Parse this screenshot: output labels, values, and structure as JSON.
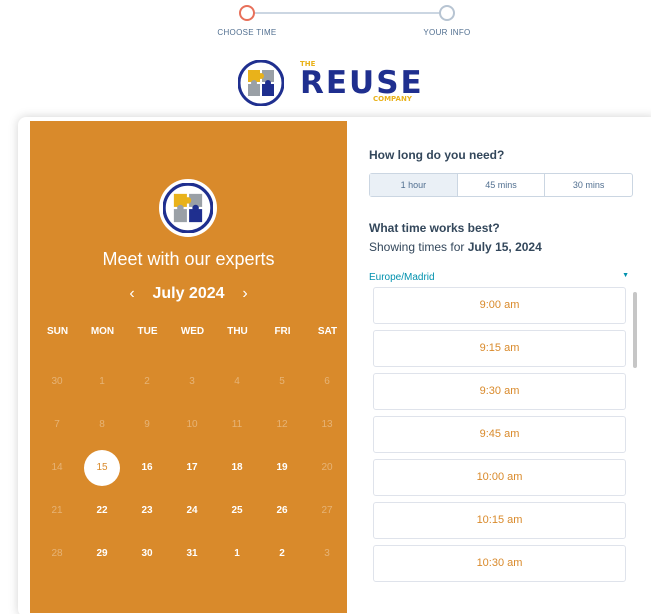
{
  "stepper": {
    "steps": [
      {
        "label": "CHOOSE TIME",
        "state": "active"
      },
      {
        "label": "YOUR INFO",
        "state": "inactive"
      }
    ]
  },
  "logo": {
    "top_text": "THE",
    "word": "REUSE",
    "bottom_text": "COMPANY",
    "icon": "puzzle-logo-icon"
  },
  "colors": {
    "accent": "#d98a2b",
    "link": "#0091ae",
    "logo_blue": "#1f2f8f",
    "logo_yellow": "#e9b21a"
  },
  "calendar": {
    "title": "Meet with our experts",
    "month_label": "July 2024",
    "prev_icon": "chevron-left-icon",
    "next_icon": "chevron-right-icon",
    "weekdays": [
      "SUN",
      "MON",
      "TUE",
      "WED",
      "THU",
      "FRI",
      "SAT"
    ],
    "weeks": [
      [
        {
          "d": "30",
          "s": "muted"
        },
        {
          "d": "1",
          "s": "muted"
        },
        {
          "d": "2",
          "s": "muted"
        },
        {
          "d": "3",
          "s": "muted"
        },
        {
          "d": "4",
          "s": "muted"
        },
        {
          "d": "5",
          "s": "muted"
        },
        {
          "d": "6",
          "s": "muted"
        }
      ],
      [
        {
          "d": "7",
          "s": "muted"
        },
        {
          "d": "8",
          "s": "muted"
        },
        {
          "d": "9",
          "s": "muted"
        },
        {
          "d": "10",
          "s": "muted"
        },
        {
          "d": "11",
          "s": "muted"
        },
        {
          "d": "12",
          "s": "muted"
        },
        {
          "d": "13",
          "s": "muted"
        }
      ],
      [
        {
          "d": "14",
          "s": "muted"
        },
        {
          "d": "15",
          "s": "selected"
        },
        {
          "d": "16",
          "s": "avail"
        },
        {
          "d": "17",
          "s": "avail"
        },
        {
          "d": "18",
          "s": "avail"
        },
        {
          "d": "19",
          "s": "avail"
        },
        {
          "d": "20",
          "s": "muted"
        }
      ],
      [
        {
          "d": "21",
          "s": "muted"
        },
        {
          "d": "22",
          "s": "avail"
        },
        {
          "d": "23",
          "s": "avail"
        },
        {
          "d": "24",
          "s": "avail"
        },
        {
          "d": "25",
          "s": "avail"
        },
        {
          "d": "26",
          "s": "avail"
        },
        {
          "d": "27",
          "s": "muted"
        }
      ],
      [
        {
          "d": "28",
          "s": "muted"
        },
        {
          "d": "29",
          "s": "avail"
        },
        {
          "d": "30",
          "s": "avail"
        },
        {
          "d": "31",
          "s": "avail"
        },
        {
          "d": "1",
          "s": "avail"
        },
        {
          "d": "2",
          "s": "avail"
        },
        {
          "d": "3",
          "s": "muted"
        }
      ]
    ]
  },
  "booking": {
    "duration_heading": "How long do you need?",
    "durations": [
      {
        "label": "1 hour",
        "active": true
      },
      {
        "label": "45 mins",
        "active": false
      },
      {
        "label": "30 mins",
        "active": false
      }
    ],
    "time_heading": "What time works best?",
    "showing_prefix": "Showing times for ",
    "showing_date": "July 15, 2024",
    "timezone": "Europe/Madrid",
    "timezone_icon": "caret-down-icon",
    "slots": [
      "9:00 am",
      "9:15 am",
      "9:30 am",
      "9:45 am",
      "10:00 am",
      "10:15 am",
      "10:30 am"
    ]
  }
}
